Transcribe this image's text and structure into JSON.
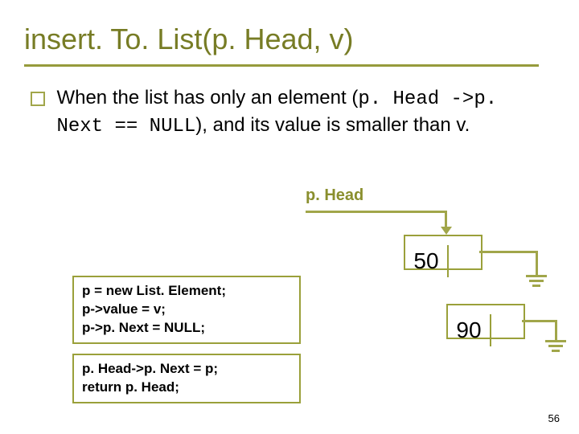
{
  "title": "insert. To. List(p. Head, v)",
  "bullet": {
    "pre": "When the list has only an element  (",
    "code": "p. Head ->p. Next == NULL",
    "post": "), and its value is smaller than v."
  },
  "label_phead": "p. Head",
  "node50": "50",
  "node90": "90",
  "code1": {
    "l1": "p = new List. Element;",
    "l2": "p->value = v;",
    "l3": "p->p. Next = NULL;"
  },
  "code2": {
    "l1": "p. Head->p. Next = p;",
    "l2": "return p. Head;"
  },
  "page": "56"
}
